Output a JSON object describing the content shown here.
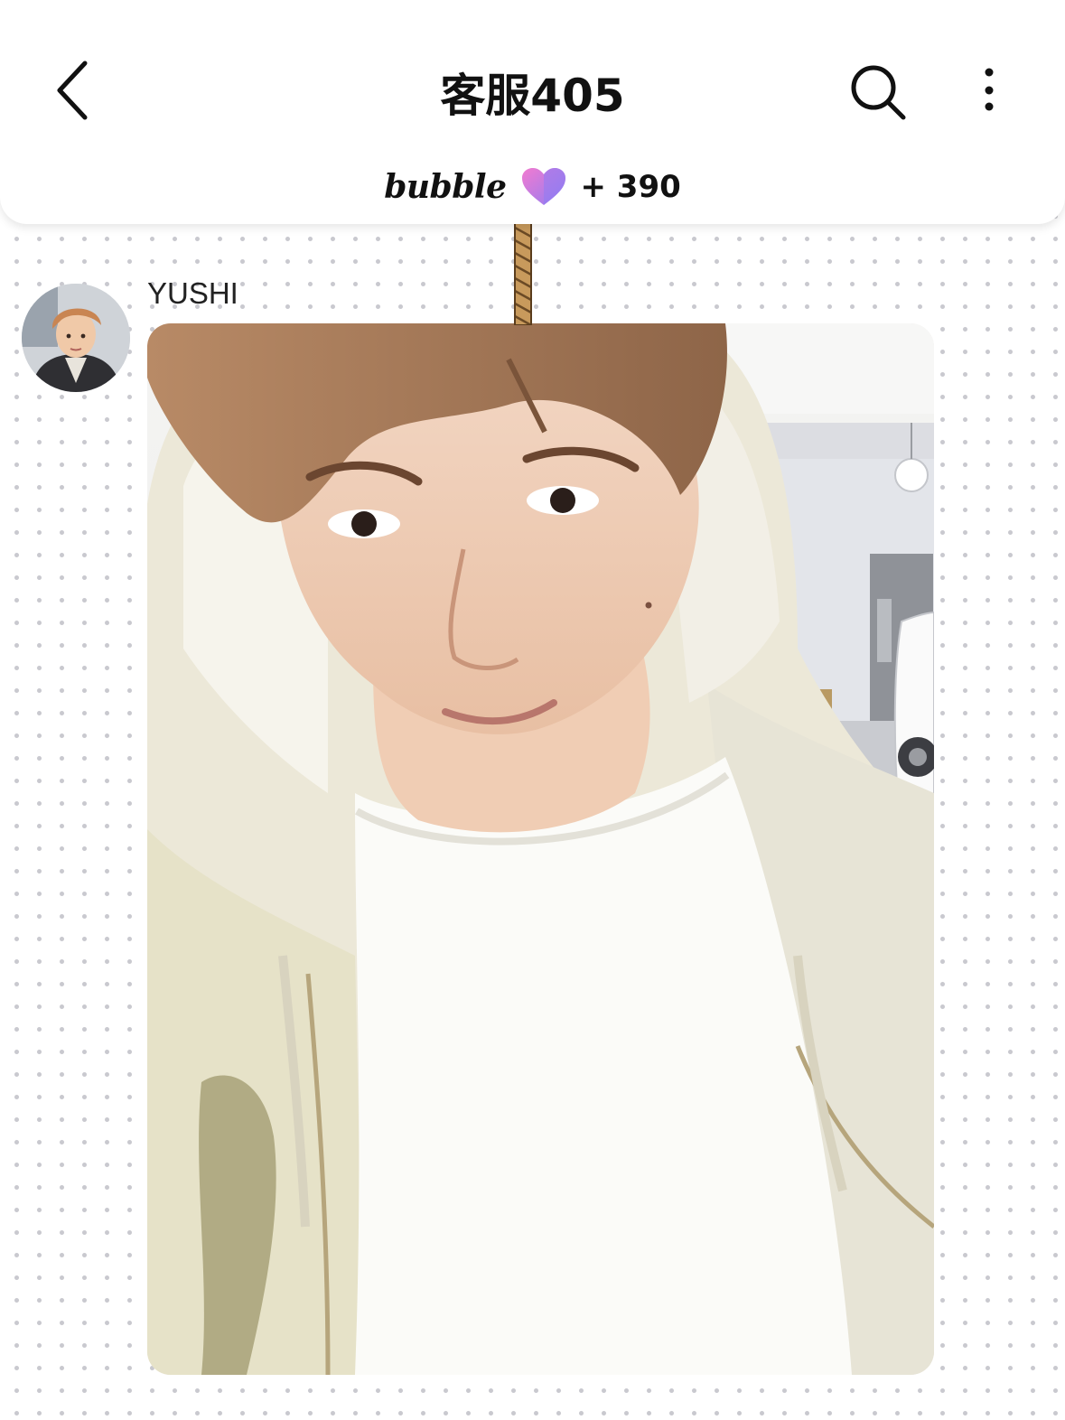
{
  "header": {
    "title": "客服405",
    "back_icon": "chevron-left-icon",
    "search_icon": "search-icon",
    "more_icon": "more-vertical-icon"
  },
  "bubble_bar": {
    "brand": "bubble",
    "heart_icon": "heart-icon",
    "count": "+ 390"
  },
  "message": {
    "sender": "YUSHI",
    "avatar_icon": "avatar",
    "content_type": "photo"
  },
  "colors": {
    "heart_pink": "#f27bd0",
    "heart_purple": "#8f7cf3",
    "rope": "#c89a5c"
  }
}
